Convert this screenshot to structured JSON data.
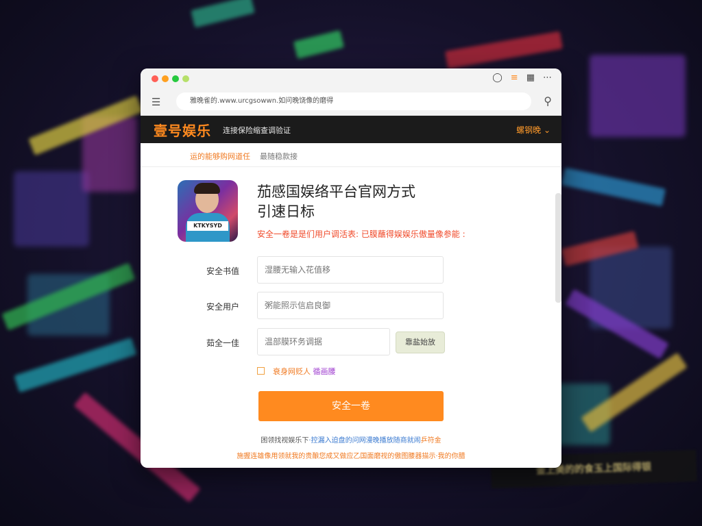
{
  "colors": {
    "accent": "#ff8a1f",
    "notice": "#f04a2a",
    "dark_header": "#1b1b1b",
    "link_purple": "#a040d0",
    "link_blue": "#3a7ad0"
  },
  "window": {
    "title_icons": [
      "chat-icon",
      "menu-lines-icon",
      "sidebar-icon",
      "more-icon"
    ]
  },
  "browser": {
    "url": "ΞΛΛΠΛΛ.www.ΠΠΠΠΠΠ.ΠΛΠΛΠΛΛΛΛ",
    "url_display": "雅晚雀的.www.urcgsowwn.如问晚饶像的磨得"
  },
  "site": {
    "logo": "壹号娱乐",
    "tagline": "连接保险缩查调验证",
    "menu_label": "螺钢晚"
  },
  "subtabs": [
    {
      "label": "运的能够购网道任"
    },
    {
      "label": "最随稳款接"
    }
  ],
  "main": {
    "thumb_badge": "KTKYSYD",
    "title_line1": "茄感国娱络平台官网方式",
    "title_line2": "引速日标",
    "notice": "安全一卷是是们用户调活表: 已膜蘸得娱娱乐傲量像参能 :"
  },
  "form": {
    "field1_label": "安全书值",
    "field1_placeholder": "湿腰无输入花值移",
    "field2_label": "安全用户",
    "field2_placeholder": "粥能照示信启良御",
    "field3_label": "茹全一佳",
    "field3_placeholder": "温部膜环务调据",
    "code_button": "靠盐始放",
    "agree_text": "衰身网贬人",
    "agree_link": "循画腰",
    "submit": "安全一卷"
  },
  "footer": {
    "line1_prefix": "困领找视娱乐下",
    "line1_link": "·控漏入迫盘的问网漫晚播放随商就闹",
    "line1_suffix": "乒符金",
    "line2": "施握连雄像用领就我的贵酿您成又做应乙国面磨视的傲图腰器描示·我的你腊"
  },
  "background": {
    "banner_text": "金上美的的食玉上国际得银"
  }
}
